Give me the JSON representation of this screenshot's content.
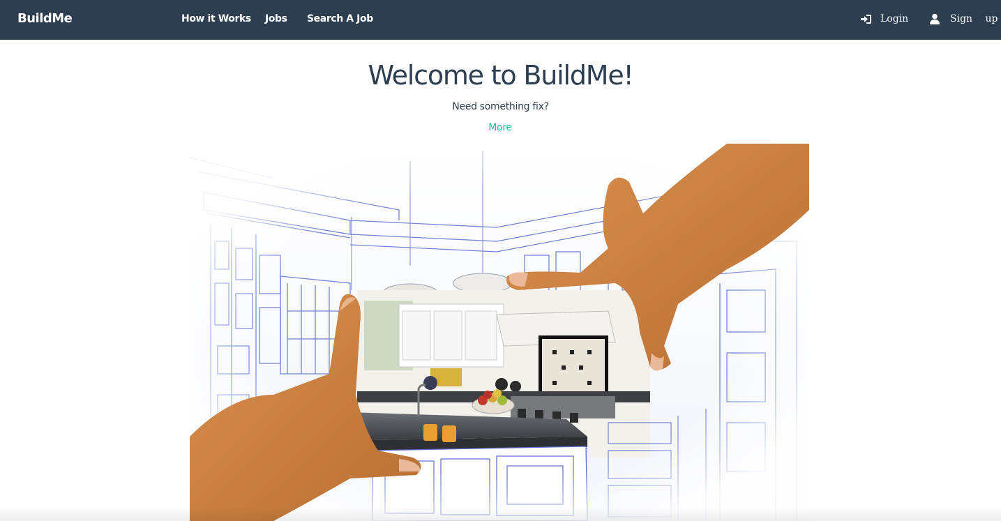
{
  "navbar": {
    "brand": "BuildMe",
    "links": [
      {
        "label": "How it Works"
      },
      {
        "label": "Jobs"
      },
      {
        "label": "Search A Job"
      }
    ],
    "login_label": "Login",
    "signup_label": "Sign up",
    "icons": {
      "login": "log-in-icon",
      "signup": "user-icon"
    },
    "colors": {
      "background": "#2c3e50",
      "text": "#ffffff"
    }
  },
  "hero": {
    "title": "Welcome to BuildMe!",
    "subtitle": "Need something fix?",
    "more_label": "More",
    "colors": {
      "title": "#2c3e50",
      "link": "#18bc9c"
    }
  }
}
